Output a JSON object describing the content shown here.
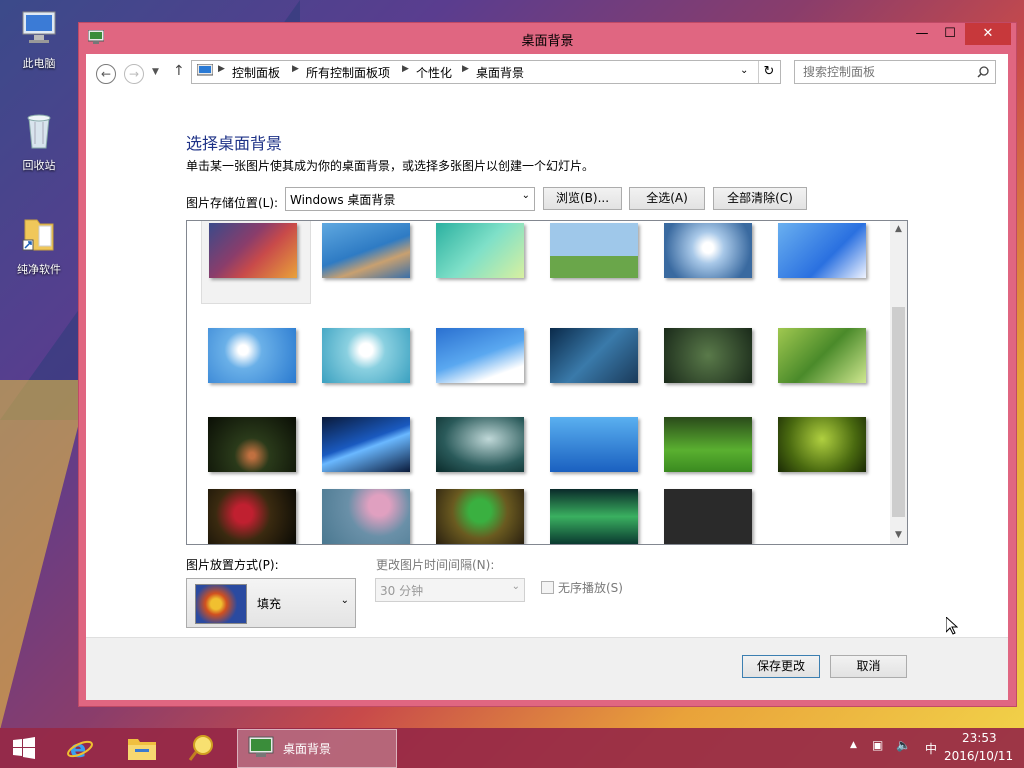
{
  "desktop": {
    "icons": [
      {
        "label": "此电脑",
        "icon": "computer-icon"
      },
      {
        "label": "回收站",
        "icon": "recycle-bin-icon"
      },
      {
        "label": "纯净软件",
        "icon": "folder-shortcut-icon"
      }
    ]
  },
  "window": {
    "title": "桌面背景",
    "controls": {
      "minimize": "—",
      "maximize": "☐",
      "close": "✕"
    }
  },
  "navbar": {
    "breadcrumb": [
      "控制面板",
      "所有控制面板项",
      "个性化",
      "桌面背景"
    ],
    "search_placeholder": "搜索控制面板"
  },
  "content": {
    "heading": "选择桌面背景",
    "description": "单击某一张图片使其成为你的桌面背景，或选择多张图片以创建一个幻灯片。",
    "location_label": "图片存储位置(L):",
    "location_value": "Windows 桌面背景",
    "browse_label": "浏览(B)...",
    "select_all_label": "全选(A)",
    "clear_all_label": "全部清除(C)",
    "position_label": "图片放置方式(P):",
    "position_value": "填充",
    "interval_label": "更改图片时间间隔(N):",
    "interval_value": "30 分钟",
    "shuffle_label": "无序播放(S)"
  },
  "footer": {
    "save_label": "保存更改",
    "cancel_label": "取消"
  },
  "taskbar": {
    "active_task": "桌面背景",
    "ime": "中",
    "time": "23:53",
    "date": "2016/10/11"
  },
  "colors": {
    "window_frame": "#e06681",
    "heading": "#1e3287",
    "taskbar": "#962846"
  }
}
